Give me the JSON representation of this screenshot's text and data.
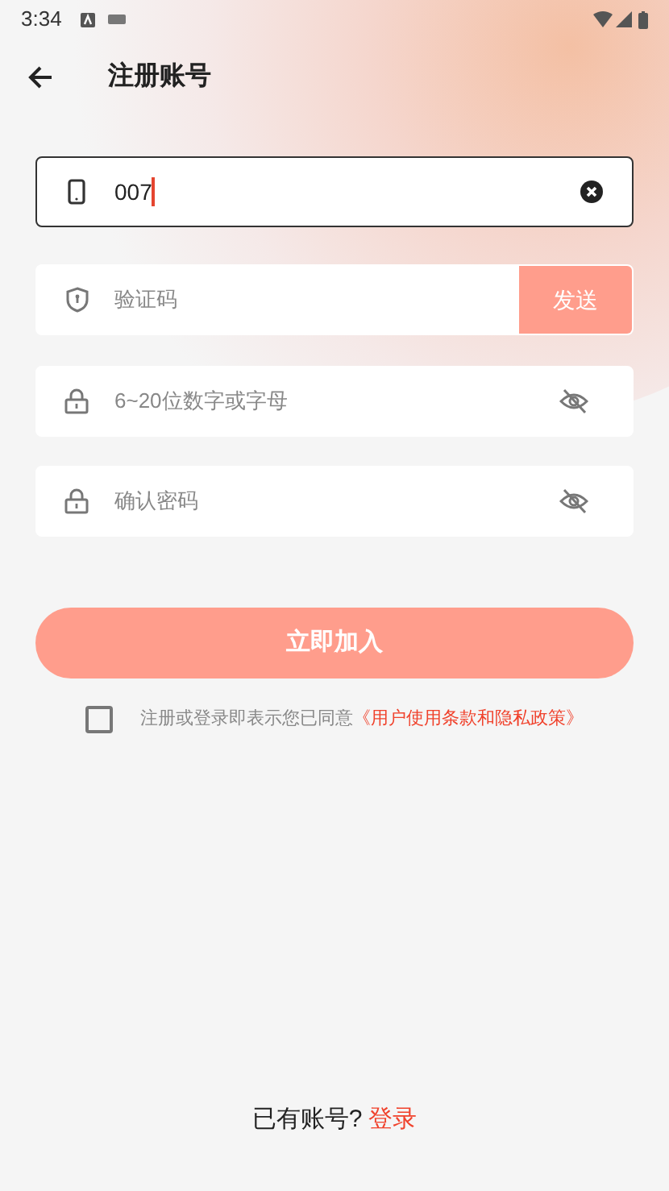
{
  "status_bar": {
    "time": "3:34"
  },
  "header": {
    "title": "注册账号"
  },
  "fields": [
    {
      "kind": "phone",
      "value": "007",
      "focused": true
    },
    {
      "kind": "code",
      "placeholder": "验证码",
      "button": "发送"
    },
    {
      "kind": "password",
      "placeholder": "6~20位数字或字母"
    },
    {
      "kind": "password",
      "placeholder": "确认密码"
    }
  ],
  "submit": "立即加入",
  "agreement": {
    "checked": false,
    "text": "注册或登录即表示您已同意",
    "link": "《用户使用条款和隐私政策》"
  },
  "footer": {
    "text": "已有账号?",
    "link": "登录"
  }
}
